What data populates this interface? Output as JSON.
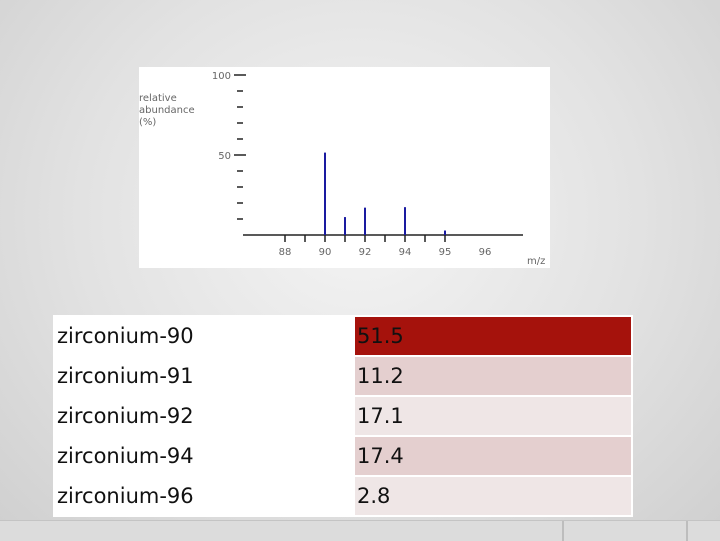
{
  "chart_data": {
    "type": "bar",
    "ylabel": "relative\nabundance\n(%)",
    "xlabel": "m/z",
    "xlim": [
      87,
      97
    ],
    "ylim": [
      0,
      100
    ],
    "x_ticks": [
      88,
      89,
      90,
      91,
      92,
      93,
      94,
      95,
      96
    ],
    "x_tick_labels": [
      "88",
      "90",
      "92",
      "94",
      "95",
      "96"
    ],
    "y_tick_labels": [
      "100",
      "50"
    ],
    "bars": [
      {
        "x": 90,
        "y": 51.5
      },
      {
        "x": 91,
        "y": 11.2
      },
      {
        "x": 92,
        "y": 17.1
      },
      {
        "x": 94,
        "y": 17.4
      },
      {
        "x": 96,
        "y": 2.8
      }
    ],
    "bar_color": "#1a1aa0"
  },
  "table": {
    "rows": [
      {
        "isotope": "zirconium-90",
        "abundance": "51.5"
      },
      {
        "isotope": "zirconium-91",
        "abundance": "11.2"
      },
      {
        "isotope": "zirconium-92",
        "abundance": "17.1"
      },
      {
        "isotope": "zirconium-94",
        "abundance": "17.4"
      },
      {
        "isotope": "zirconium-96",
        "abundance": "2.8"
      }
    ]
  }
}
